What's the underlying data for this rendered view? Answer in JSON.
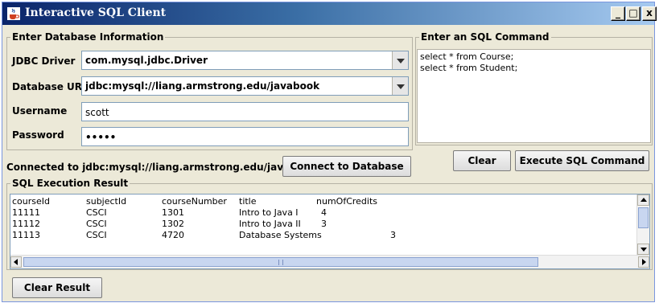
{
  "window": {
    "title": "Interactive SQL Client",
    "controls": {
      "minimize": "_",
      "maximize": "□",
      "close": "x"
    },
    "icon": "java-cup-icon"
  },
  "db_info": {
    "group_title": "Enter Database Information",
    "jdbc_driver_label": "JDBC Driver",
    "jdbc_driver_value": "com.mysql.jdbc.Driver",
    "database_url_label": "Database URL",
    "database_url_value": "jdbc:mysql://liang.armstrong.edu/javabook",
    "username_label": "Username",
    "username_value": "scott",
    "password_label": "Password",
    "password_value": "•••••"
  },
  "sql_command": {
    "group_title": "Enter an SQL Command",
    "lines": [
      "select * from Course;",
      "select * from Student;"
    ],
    "clear_label": "Clear",
    "execute_label": "Execute SQL Command"
  },
  "status": {
    "connection_text": "Connected to jdbc:mysql://liang.armstrong.edu/javabook",
    "connect_label": "Connect to Database"
  },
  "result": {
    "group_title": "SQL Execution Result",
    "columns": [
      "courseId",
      "subjectId",
      "courseNumber",
      "title",
      "numOfCredits"
    ],
    "rows": [
      [
        "11111",
        "CSCI",
        "1301",
        "Intro to Java I",
        "4"
      ],
      [
        "11112",
        "CSCI",
        "1302",
        "Intro to Java II",
        "3"
      ],
      [
        "11113",
        "CSCI",
        "4720",
        "Database Systems",
        "3"
      ]
    ],
    "clear_result_label": "Clear Result"
  }
}
